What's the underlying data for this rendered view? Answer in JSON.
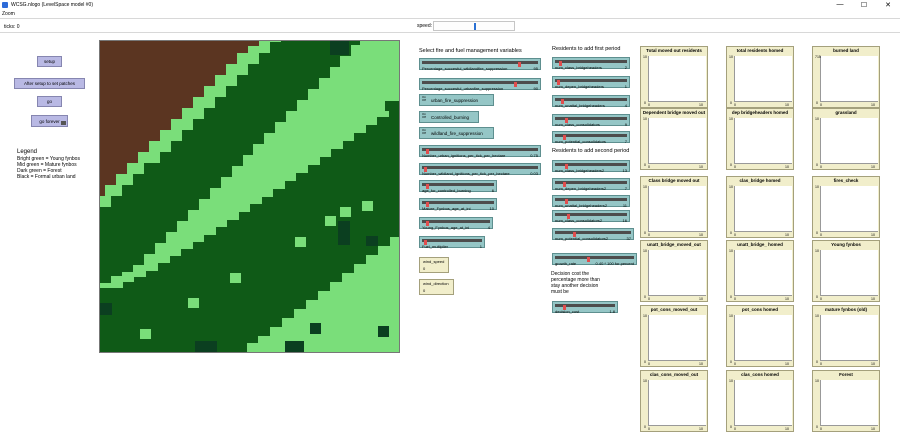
{
  "window": {
    "title": "WCSG.nlogo (LevelSpace model #0)",
    "controls": [
      "—",
      "☐",
      "✕"
    ]
  },
  "menu": {
    "zoom": "Zoom"
  },
  "toolbar": {
    "ticks": "ticks: 0",
    "speed_label": "speed:"
  },
  "buttons": {
    "setup": "setup",
    "after_setup": "After setup to set patches",
    "go": "go",
    "go_forever": "go forever"
  },
  "legend": {
    "title": "Legend",
    "lines": [
      "Bright green = Young fynbos",
      "Mid green = Mature fynbos",
      "Dark green = Forest",
      "Black = Formal urban land"
    ]
  },
  "colors": {
    "young_fynbos": "#7ade7a",
    "mature_fynbos": "#0f5a17",
    "forest": "#0b3f20",
    "urban": "#5b3521",
    "button": "#b9b9e4",
    "widget": "#95c6c6",
    "plot": "#f1eecb"
  },
  "fire": {
    "header": "Select fire and fuel management variables",
    "slider1_label": "Percentage_succesful_wildlandfire_suppression",
    "slider1_value": "95",
    "slider2_label": "Percentage_succesful_urbanfire_suppression",
    "slider2_value": "90",
    "switch1_label": "urban_fire_suppression",
    "switch2_label": "Controlled_burning",
    "switch3_label": "wildland_fire_suppression",
    "switch_state": "On Off",
    "slider3_label": "Number_urban_ignitions_per_tick_per_hectare",
    "slider3_value": "0.75",
    "slider4_label": "Number_wildland_ignitions_per_tick_per_hectare",
    "slider4_value": "0.03",
    "slider5_label": "age_for_controlled_burning",
    "slider5_value": "6",
    "slider6_label": "Mature_Fynbos_age_at_ini",
    "slider6_value": "10",
    "slider7_label": "Young_Fynbos_age_at_ini",
    "slider7_value": "4",
    "slider8_label": "Fuel_multiplier",
    "slider8_value": "1",
    "input1_label": "wind_speed",
    "input1_value": "0",
    "input2_label": "wind_direction",
    "input2_value": "0"
  },
  "residents": {
    "header1": "Residents to add first period",
    "r1_label": "num_class_bridgeheaders",
    "r1_value": "2",
    "r2_label": "num_depen_bridgeheaders",
    "r2_value": "1",
    "r3_label": "num_unattal_bridgeheaders",
    "r3_value": "4",
    "r4_label": "num_class_consolidators",
    "r4_value": "9",
    "r5_label": "num_potential_consolidators",
    "r5_value": "7",
    "header2": "Residents to add second period",
    "s1_label": "num_class_bridgeheaders2",
    "s1_value": "13",
    "s2_label": "num_depen_bridgeheaders2",
    "s2_value": "7",
    "s3_label": "num_unattal_bridgeheaders2",
    "s3_value": "11",
    "s4_label": "num_class_consolidators2",
    "s4_value": "16",
    "s5_label": "num_potential_consolidators2",
    "s5_value": "37",
    "growth_label": "growth_rate",
    "growth_value": "0.40 * 100 for percent",
    "note": "Decision cost the percentage more than stay another decision must be",
    "cost_label": "decision_cost",
    "cost_value": "1.8"
  },
  "plots": [
    {
      "title": "Total moved out residents",
      "ymax": "10",
      "ymin": "0",
      "xmin": "0",
      "xmax": "10"
    },
    {
      "title": "total residents homed",
      "ymax": "10",
      "ymin": "0",
      "xmin": "0",
      "xmax": "10"
    },
    {
      "title": "burned land",
      "ymax": "715",
      "ymin": "0",
      "xmin": "0",
      "xmax": "10"
    },
    {
      "title": "Dependent bridge moved out",
      "ymax": "10",
      "ymin": "0",
      "xmin": "0",
      "xmax": "10"
    },
    {
      "title": "dep bridgeheaders homed",
      "ymax": "10",
      "ymin": "0",
      "xmin": "0",
      "xmax": "10"
    },
    {
      "title": "grassland",
      "ymax": "10",
      "ymin": "0",
      "xmin": "0",
      "xmax": "10"
    },
    {
      "title": "Class bridge moved out",
      "ymax": "10",
      "ymin": "0",
      "xmin": "0",
      "xmax": "10"
    },
    {
      "title": "clas_bridge homed",
      "ymax": "10",
      "ymin": "0",
      "xmin": "0",
      "xmax": "10"
    },
    {
      "title": "fires_check",
      "ymax": "10",
      "ymin": "0",
      "xmin": "0",
      "xmax": "10"
    },
    {
      "title": "unatt_bridge_moved_out",
      "ymax": "10",
      "ymin": "0",
      "xmin": "0",
      "xmax": "10"
    },
    {
      "title": "unatt_bridge_ homed",
      "ymax": "10",
      "ymin": "0",
      "xmin": "0",
      "xmax": "10"
    },
    {
      "title": "Young fynbos",
      "ymax": "10",
      "ymin": "0",
      "xmin": "0",
      "xmax": "10"
    },
    {
      "title": "pot_cons_moved_out",
      "ymax": "10",
      "ymin": "0",
      "xmin": "0",
      "xmax": "10"
    },
    {
      "title": "pot_cons homed",
      "ymax": "10",
      "ymin": "0",
      "xmin": "0",
      "xmax": "10"
    },
    {
      "title": "mature fynbos (old)",
      "ymax": "10",
      "ymin": "0",
      "xmin": "0",
      "xmax": "10"
    },
    {
      "title": "clas_cons_moved_out",
      "ymax": "10",
      "ymin": "0",
      "xmin": "0",
      "xmax": "10"
    },
    {
      "title": "clas_cons homed",
      "ymax": "10",
      "ymin": "0",
      "xmin": "0",
      "xmax": "10"
    },
    {
      "title": "Forest",
      "ymax": "10",
      "ymin": "0",
      "xmin": "0",
      "xmax": "10"
    }
  ]
}
